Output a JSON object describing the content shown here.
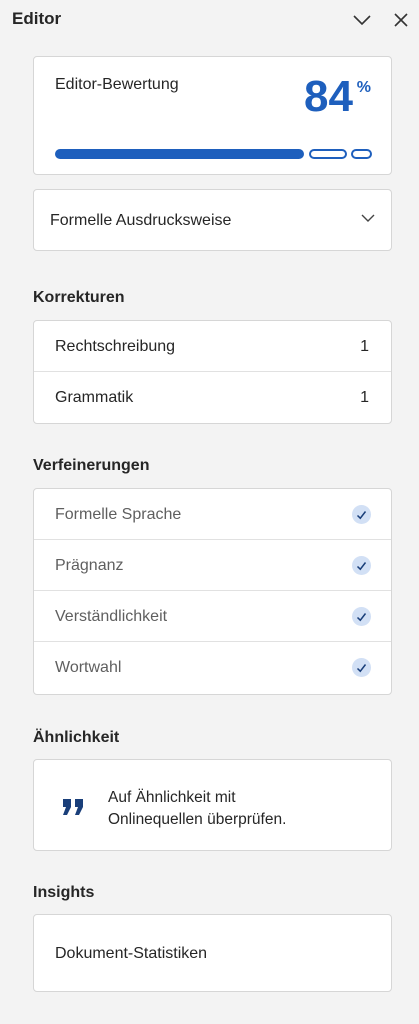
{
  "pane": {
    "title": "Editor",
    "collapse_icon": "chevron-down-icon",
    "close_icon": "close-icon"
  },
  "score": {
    "label": "Editor-Bewertung",
    "value": "84",
    "unit": "%",
    "progress_fraction": 0.84,
    "accent_color": "#1e5fbd"
  },
  "style_select": {
    "value": "Formelle Ausdrucksweise",
    "icon": "chevron-down-icon"
  },
  "corrections": {
    "heading": "Korrekturen",
    "items": [
      {
        "label": "Rechtschreibung",
        "count": "1"
      },
      {
        "label": "Grammatik",
        "count": "1"
      }
    ]
  },
  "refinements": {
    "heading": "Verfeinerungen",
    "items": [
      {
        "label": "Formelle Sprache",
        "status_icon": "checkmark-icon"
      },
      {
        "label": "Prägnanz",
        "status_icon": "checkmark-icon"
      },
      {
        "label": "Verständlichkeit",
        "status_icon": "checkmark-icon"
      },
      {
        "label": "Wortwahl",
        "status_icon": "checkmark-icon"
      }
    ]
  },
  "similarity": {
    "heading": "Ähnlichkeit",
    "icon": "quote-icon",
    "line1": "Auf Ähnlichkeit mit",
    "line2": "Onlinequellen überprüfen."
  },
  "insights": {
    "heading": "Insights",
    "item": "Dokument-Statistiken"
  }
}
